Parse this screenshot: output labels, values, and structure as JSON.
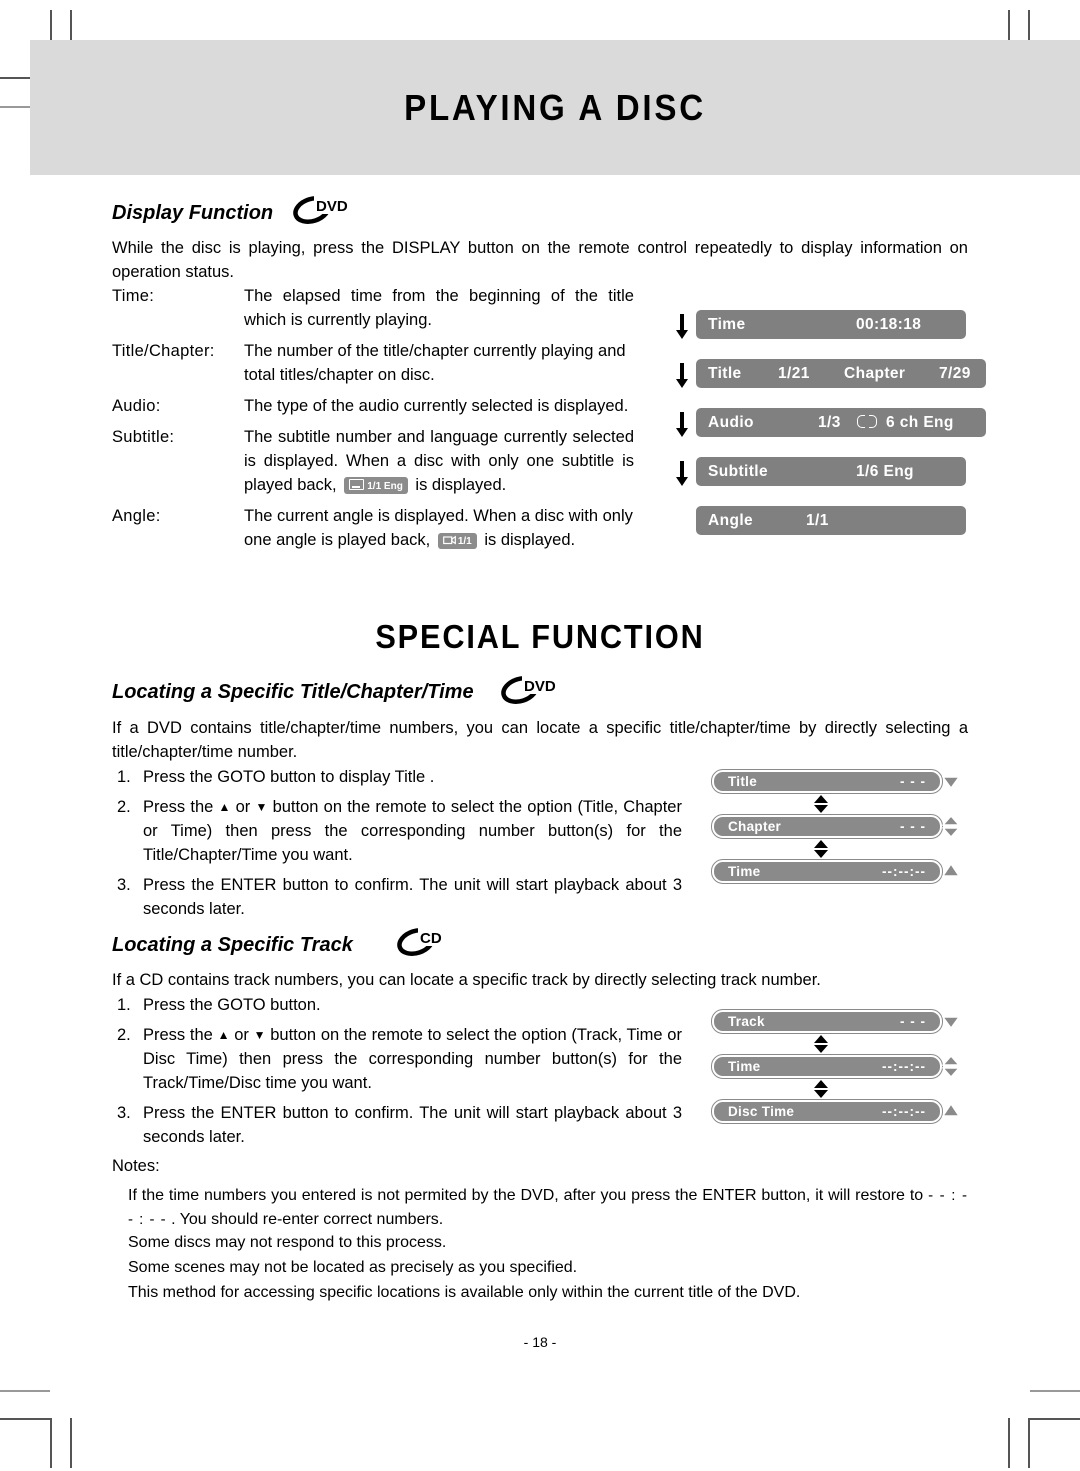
{
  "page": {
    "title": "PLAYING A DISC",
    "number": "- 18 -"
  },
  "display_function": {
    "heading": "Display Function",
    "disc_badge": "DVD",
    "intro": "While the disc is playing, press the DISPLAY button on the remote control repeatedly to display information on operation status.",
    "definitions": [
      {
        "term": "Time:",
        "desc": "The elapsed time from the beginning of the title which is currently playing."
      },
      {
        "term": "Title/Chapter:",
        "desc": "The number of the title/chapter currently playing and total titles/chapter on disc."
      },
      {
        "term": "Audio:",
        "desc": "The type of the audio currently selected is displayed."
      },
      {
        "term": "Subtitle:",
        "desc_before": "The subtitle number and language currently selected is displayed. When a disc with only one subtitle is played back,",
        "badge": "1/1 Eng",
        "desc_after": "is displayed."
      },
      {
        "term": "Angle:",
        "desc_before": "The current angle is displayed. When a disc with only one angle is played back,",
        "badge": "1/1",
        "desc_after": "is displayed."
      }
    ],
    "osd_bars": [
      {
        "label": "Time",
        "value": "00:18:18",
        "arrow": true
      },
      {
        "label": "Title",
        "value": "1/21",
        "label2": "Chapter",
        "value2": "7/29",
        "arrow": true
      },
      {
        "label": "Audio",
        "value": "1/3",
        "dolby": true,
        "value2": "6 ch  Eng",
        "arrow": true
      },
      {
        "label": "Subtitle",
        "value": "1/6 Eng",
        "arrow": true
      },
      {
        "label": "Angle",
        "value": "1/1",
        "arrow": false
      }
    ]
  },
  "special_function": {
    "heading": "SPECIAL FUNCTION",
    "title_chapter_time": {
      "heading": "Locating a Specific Title/Chapter/Time",
      "disc_badge": "DVD",
      "intro": "If a DVD contains title/chapter/time numbers, you can locate a specific title/chapter/time by directly selecting a title/chapter/time number.",
      "steps": [
        {
          "num": "1.",
          "text": "Press the GOTO button to display Title ."
        },
        {
          "num": "2.",
          "text_a": "Press the ",
          "text_b": " or ",
          "text_c": " button on the remote to select the option (Title, Chapter or Time) then press the corresponding number button(s) for the Title/Chapter/Time you want."
        },
        {
          "num": "3.",
          "text": "Press the ENTER button to confirm. The unit will start playback about 3 seconds later."
        }
      ],
      "widgets": [
        {
          "label": "Title",
          "value": "- - -",
          "side": "down"
        },
        {
          "label": "Chapter",
          "value": "- - -",
          "side": "updown"
        },
        {
          "label": "Time",
          "value": "--:--:--",
          "side": "up"
        }
      ]
    },
    "track": {
      "heading": "Locating a Specific Track",
      "disc_badge": "CD",
      "intro": "If a CD contains track numbers, you can locate a specific track by directly selecting track number.",
      "steps": [
        {
          "num": "1.",
          "text": "Press the GOTO button."
        },
        {
          "num": "2.",
          "text_a": "Press the ",
          "text_b": " or ",
          "text_c": " button on the remote to select the option (Track, Time or Disc Time) then press the corresponding number button(s) for the Track/Time/Disc time you want."
        },
        {
          "num": "3.",
          "text": "Press the ENTER button to confirm. The unit will start playback about 3 seconds later."
        }
      ],
      "widgets": [
        {
          "label": "Track",
          "value": "- - -",
          "side": "down"
        },
        {
          "label": "Time",
          "value": "--:--:--",
          "side": "updown"
        },
        {
          "label": "Disc Time",
          "value": "--:--:--",
          "side": "up"
        }
      ]
    }
  },
  "notes": {
    "label": "Notes:",
    "items": [
      {
        "text_a": "If the time numbers you entered is not permited by the DVD, after you press the ENTER button, it will restore to ",
        "dashes": "- - : - - : - -",
        "text_b": " . You should re-enter correct numbers."
      },
      {
        "text": "Some discs may not respond to this process."
      },
      {
        "text": "Some scenes may not be located as precisely as you specified."
      },
      {
        "text": "This method for accessing specific locations is available only within the current title of the DVD."
      }
    ]
  },
  "colors": {
    "header_band": "#dadada",
    "osd_bar": "#808080",
    "widget_bar": "#8a8a8a",
    "badge": "#8c8c8c"
  }
}
